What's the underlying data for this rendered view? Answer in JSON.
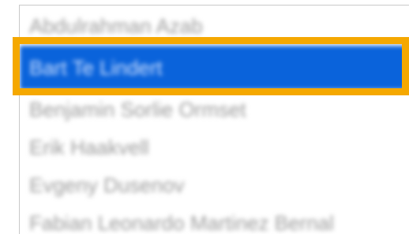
{
  "listbox": {
    "options": [
      {
        "label": "Abdulrahman Azab"
      },
      {
        "label": "Bart Te Lindert"
      },
      {
        "label": "Benjamin Sorlie Ormset"
      },
      {
        "label": "Erik Haakvell"
      },
      {
        "label": "Evgeny Dusenov"
      },
      {
        "label": "Fabian Leonardo Martinez Bernal"
      }
    ],
    "selected_index": 1
  },
  "colors": {
    "selection": "#0a63db",
    "highlight_outline": "#f5a800",
    "option_text": "#9c9c9c"
  }
}
